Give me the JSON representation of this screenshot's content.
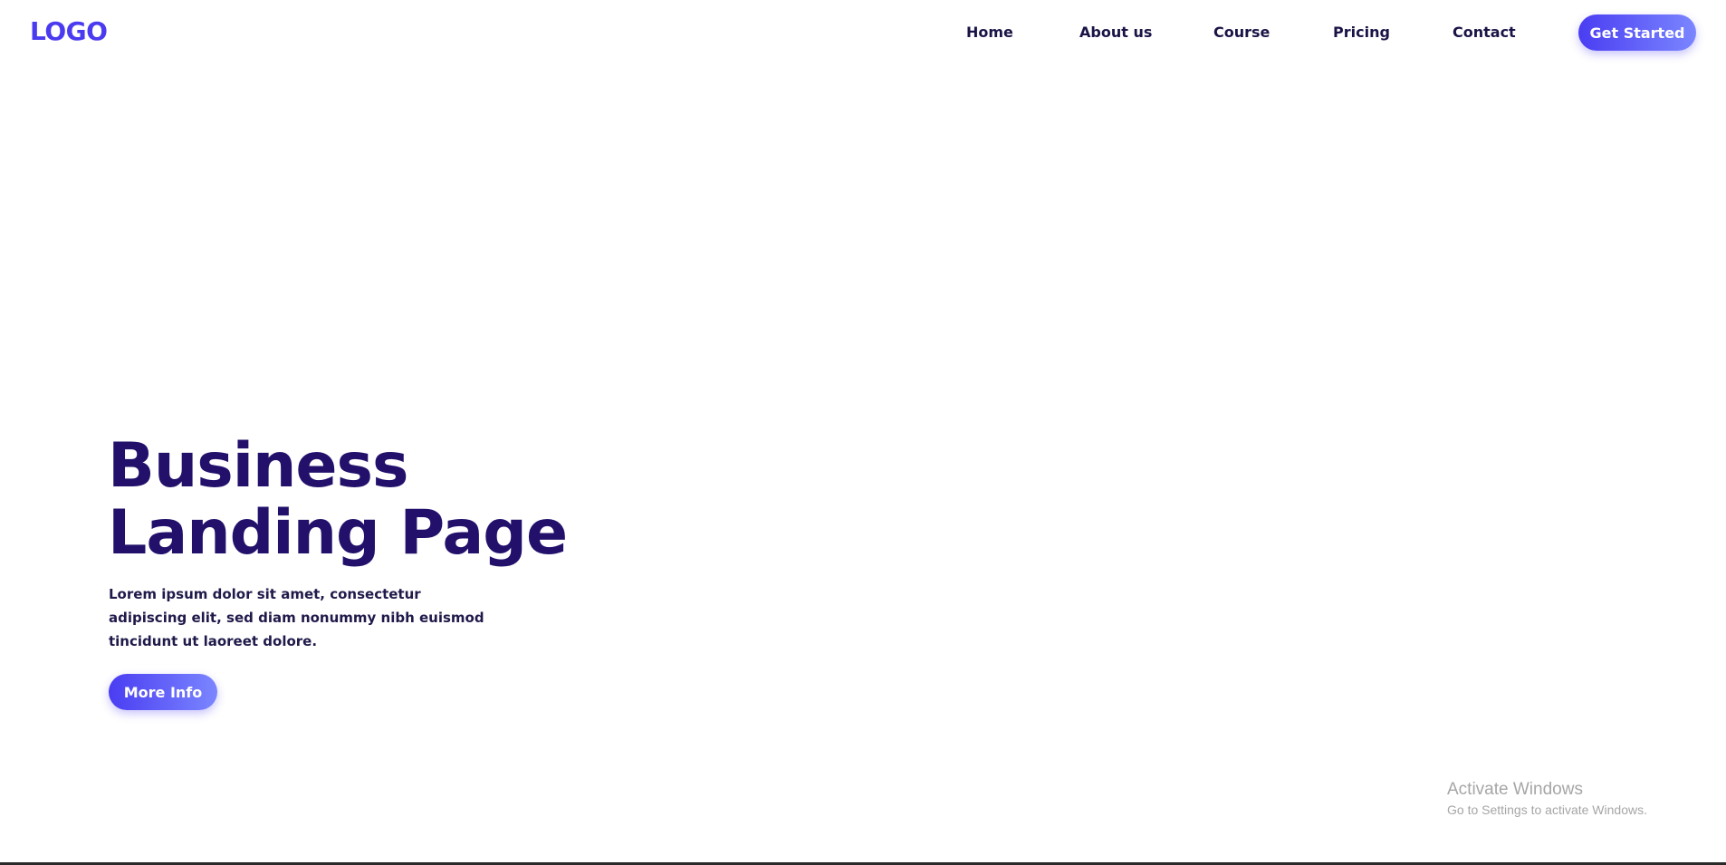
{
  "header": {
    "logo_text": "LOGO",
    "nav_items": [
      {
        "label": "Home"
      },
      {
        "label": "About us"
      },
      {
        "label": "Course"
      },
      {
        "label": "Pricing"
      },
      {
        "label": "Contact"
      }
    ],
    "cta_label": "Get Started"
  },
  "hero": {
    "title_line1": "Business",
    "title_line2": "Landing Page",
    "description": "Lorem ipsum dolor sit amet, consectetur adipiscing elit, sed diam nonummy nibh euismod tincidunt ut laoreet dolore.",
    "button_label": "More Info"
  },
  "watermark": {
    "title": "Activate Windows",
    "subtitle": "Go to Settings to activate Windows."
  },
  "colors": {
    "brand_primary": "#4a3df2",
    "brand_gradient_end": "#7b86ff",
    "heading": "#22106b",
    "nav_text": "#1a1446",
    "body_text": "#1f1a4a",
    "watermark_text": "#a6a6a6",
    "background": "#ffffff"
  }
}
